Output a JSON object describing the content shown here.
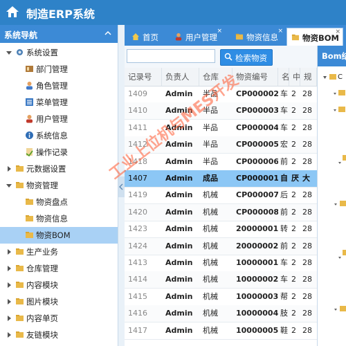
{
  "app": {
    "title": "制造ERP系统"
  },
  "sidebar": {
    "title": "系统导航",
    "items": [
      {
        "label": "系统设置",
        "icon": "settings-icon",
        "level": 0,
        "expanded": true
      },
      {
        "label": "部门管理",
        "icon": "department-icon",
        "level": 1
      },
      {
        "label": "角色管理",
        "icon": "role-icon",
        "level": 1
      },
      {
        "label": "菜单管理",
        "icon": "menu-icon",
        "level": 1
      },
      {
        "label": "用户管理",
        "icon": "user-icon",
        "level": 1
      },
      {
        "label": "系统信息",
        "icon": "info-icon",
        "level": 1
      },
      {
        "label": "操作记录",
        "icon": "log-icon",
        "level": 1
      },
      {
        "label": "元数据设置",
        "icon": "folder-icon",
        "level": 0,
        "expanded": false
      },
      {
        "label": "物资管理",
        "icon": "folder-icon",
        "level": 0,
        "expanded": true
      },
      {
        "label": "物资盘点",
        "icon": "folder-icon",
        "level": 1
      },
      {
        "label": "物资信息",
        "icon": "folder-icon",
        "level": 1
      },
      {
        "label": "物资BOM",
        "icon": "folder-icon",
        "level": 1,
        "active": true
      },
      {
        "label": "生产业务",
        "icon": "folder-icon",
        "level": 0,
        "expanded": false
      },
      {
        "label": "仓库管理",
        "icon": "folder-icon",
        "level": 0,
        "expanded": false
      },
      {
        "label": "内容模块",
        "icon": "folder-icon",
        "level": 0,
        "expanded": false
      },
      {
        "label": "图片模块",
        "icon": "folder-icon",
        "level": 0,
        "expanded": false
      },
      {
        "label": "内容单页",
        "icon": "folder-icon",
        "level": 0,
        "expanded": false
      },
      {
        "label": "友链模块",
        "icon": "folder-icon",
        "level": 0,
        "expanded": false
      }
    ]
  },
  "tabs": [
    {
      "label": "首页",
      "icon": "home-icon"
    },
    {
      "label": "用户管理",
      "icon": "user-icon",
      "closable": true
    },
    {
      "label": "物资信息",
      "icon": "folder-icon",
      "closable": true
    },
    {
      "label": "物资BOM",
      "icon": "folder-icon",
      "closable": true,
      "active": true
    }
  ],
  "search": {
    "placeholder": "",
    "value": "",
    "button_label": "检索物资"
  },
  "table": {
    "columns": [
      "记录号",
      "负责人",
      "仓库",
      "物资编号",
      "名",
      "中",
      "规"
    ],
    "rows": [
      [
        "1409",
        "Admin",
        "半品",
        "CP000002",
        "车",
        "2",
        "28"
      ],
      [
        "1410",
        "Admin",
        "半品",
        "CP000003",
        "车",
        "2",
        "28"
      ],
      [
        "1411",
        "Admin",
        "半品",
        "CP000004",
        "车",
        "2",
        "28"
      ],
      [
        "1412",
        "Admin",
        "半品",
        "CP000005",
        "宏",
        "2",
        "28"
      ],
      [
        "1418",
        "Admin",
        "半品",
        "CP000006",
        "前",
        "2",
        "28"
      ],
      [
        "1407",
        "Admin",
        "成品",
        "CP000001",
        "自",
        "厌",
        "大"
      ],
      [
        "1419",
        "Admin",
        "机械",
        "CP000007",
        "后",
        "2",
        "28"
      ],
      [
        "1420",
        "Admin",
        "机械",
        "CP000008",
        "前",
        "2",
        "28"
      ],
      [
        "1423",
        "Admin",
        "机械",
        "20000001",
        "转",
        "2",
        "28"
      ],
      [
        "1424",
        "Admin",
        "机械",
        "20000002",
        "前",
        "2",
        "28"
      ],
      [
        "1413",
        "Admin",
        "机械",
        "10000001",
        "车",
        "2",
        "28"
      ],
      [
        "1414",
        "Admin",
        "机械",
        "10000002",
        "车",
        "2",
        "28"
      ],
      [
        "1415",
        "Admin",
        "机械",
        "10000003",
        "帮",
        "2",
        "28"
      ],
      [
        "1416",
        "Admin",
        "机械",
        "10000004",
        "肢",
        "2",
        "28"
      ],
      [
        "1417",
        "Admin",
        "机械",
        "10000005",
        "鞋",
        "2",
        "28"
      ]
    ],
    "selected_index": 5
  },
  "bom_panel": {
    "title": "Bom结构"
  },
  "watermark": "工业上位机与MES开发",
  "colors": {
    "header": "#2e82c8",
    "tab_bar": "#3c8ad6",
    "selected_row": "#8cc7f5",
    "active_nav": "#a9d1f5"
  }
}
